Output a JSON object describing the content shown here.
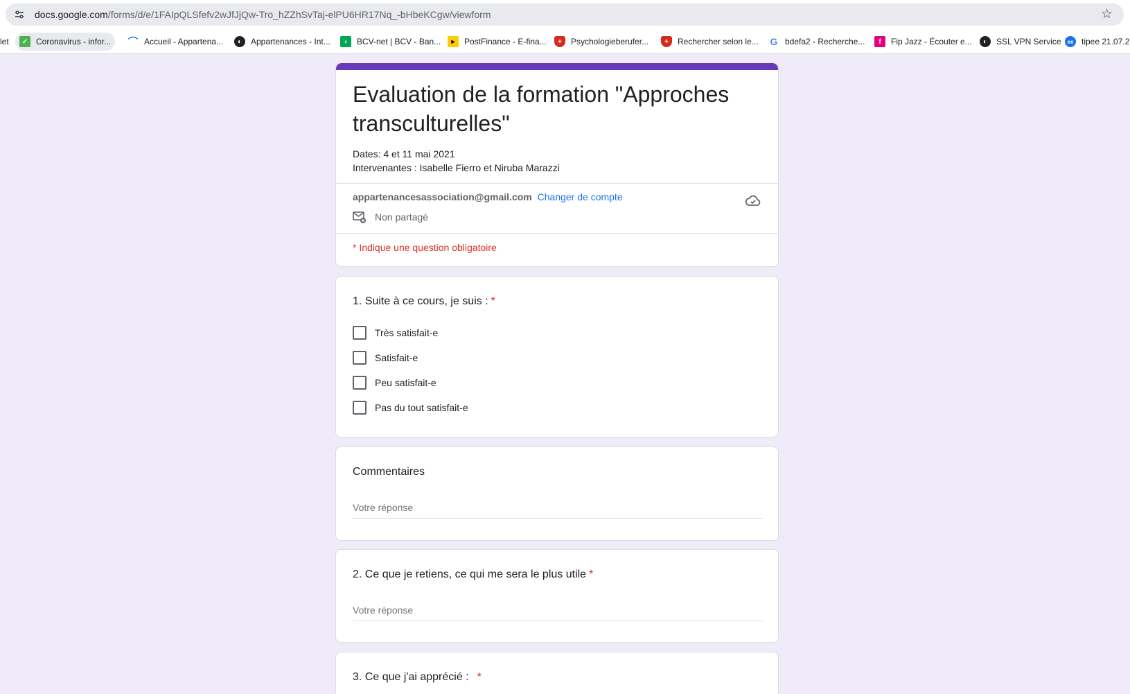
{
  "browser": {
    "url_host": "docs.google.com",
    "url_path": "/forms/d/e/1FAIpQLSfefv2wJfJjQw-Tro_hZZhSvTaj-elPU6HR17Nq_-bHbeKCgw/viewform",
    "bookmarks": [
      {
        "label": "let",
        "icon": "none"
      },
      {
        "label": "Coronavirus - infor...",
        "icon": "shield-green",
        "color": "#4caf50"
      },
      {
        "label": "Accueil - Appartena...",
        "icon": "wave",
        "color": "#1a73e8"
      },
      {
        "label": "Appartenances - Int...",
        "icon": "globe",
        "color": "#202124"
      },
      {
        "label": "BCV-net | BCV - Ban...",
        "icon": "bcv",
        "color": "#00a651"
      },
      {
        "label": "PostFinance - E-fina...",
        "icon": "postfinance",
        "color": "#ffcc00"
      },
      {
        "label": "Psychologieberufer...",
        "icon": "swiss-shield",
        "color": "#d52b1e"
      },
      {
        "label": "Rechercher selon le...",
        "icon": "swiss-shield",
        "color": "#d52b1e"
      },
      {
        "label": "bdefa2 - Recherche...",
        "icon": "google",
        "color": "#4285f4"
      },
      {
        "label": "Fip Jazz - Écouter e...",
        "icon": "fip",
        "color": "#e6007e"
      },
      {
        "label": "SSL VPN Service",
        "icon": "globe",
        "color": "#202124"
      },
      {
        "label": "tipee 21.07.2",
        "icon": "ee",
        "color": "#1a73e8"
      }
    ]
  },
  "form": {
    "title": "Evaluation de la formation \"Approches transculturelles\"",
    "desc_line1": "Dates:  4 et 11 mai 2021",
    "desc_line2": "Intervenantes : Isabelle Fierro et Niruba Marazzi",
    "account_email": "appartenancesassociation@gmail.com",
    "switch_account": "Changer de compte",
    "not_shared": "Non partagé",
    "required_note": "* Indique une question obligatoire",
    "accent_color": "#673ab7"
  },
  "questions": {
    "q1": {
      "title": "1. Suite à ce cours, je suis :",
      "required": "*",
      "options": [
        "Très satisfait-e",
        "Satisfait-e",
        "Peu satisfait-e",
        "Pas du tout satisfait-e"
      ]
    },
    "comments": {
      "title": "Commentaires",
      "placeholder": "Votre réponse"
    },
    "q2": {
      "title": "2. Ce que je retiens, ce qui me sera le plus utile",
      "required": "*",
      "placeholder": "Votre réponse"
    },
    "q3": {
      "title": "3. Ce que j'ai apprécié :",
      "required": "*"
    }
  }
}
